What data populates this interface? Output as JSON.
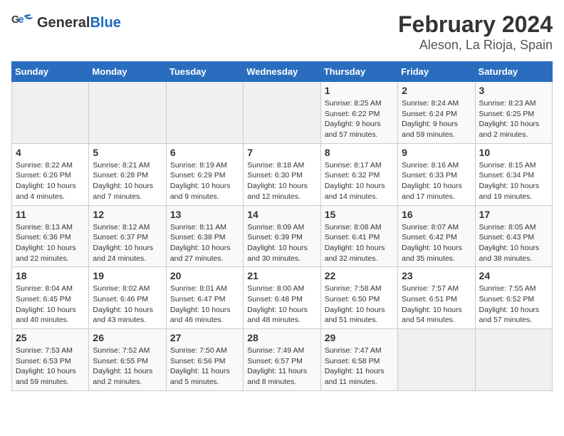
{
  "logo": {
    "text_general": "General",
    "text_blue": "Blue"
  },
  "title": "February 2024",
  "subtitle": "Aleson, La Rioja, Spain",
  "headers": [
    "Sunday",
    "Monday",
    "Tuesday",
    "Wednesday",
    "Thursday",
    "Friday",
    "Saturday"
  ],
  "weeks": [
    [
      {
        "day": "",
        "info": ""
      },
      {
        "day": "",
        "info": ""
      },
      {
        "day": "",
        "info": ""
      },
      {
        "day": "",
        "info": ""
      },
      {
        "day": "1",
        "info": "Sunrise: 8:25 AM\nSunset: 6:22 PM\nDaylight: 9 hours\nand 57 minutes."
      },
      {
        "day": "2",
        "info": "Sunrise: 8:24 AM\nSunset: 6:24 PM\nDaylight: 9 hours\nand 59 minutes."
      },
      {
        "day": "3",
        "info": "Sunrise: 8:23 AM\nSunset: 6:25 PM\nDaylight: 10 hours\nand 2 minutes."
      }
    ],
    [
      {
        "day": "4",
        "info": "Sunrise: 8:22 AM\nSunset: 6:26 PM\nDaylight: 10 hours\nand 4 minutes."
      },
      {
        "day": "5",
        "info": "Sunrise: 8:21 AM\nSunset: 6:28 PM\nDaylight: 10 hours\nand 7 minutes."
      },
      {
        "day": "6",
        "info": "Sunrise: 8:19 AM\nSunset: 6:29 PM\nDaylight: 10 hours\nand 9 minutes."
      },
      {
        "day": "7",
        "info": "Sunrise: 8:18 AM\nSunset: 6:30 PM\nDaylight: 10 hours\nand 12 minutes."
      },
      {
        "day": "8",
        "info": "Sunrise: 8:17 AM\nSunset: 6:32 PM\nDaylight: 10 hours\nand 14 minutes."
      },
      {
        "day": "9",
        "info": "Sunrise: 8:16 AM\nSunset: 6:33 PM\nDaylight: 10 hours\nand 17 minutes."
      },
      {
        "day": "10",
        "info": "Sunrise: 8:15 AM\nSunset: 6:34 PM\nDaylight: 10 hours\nand 19 minutes."
      }
    ],
    [
      {
        "day": "11",
        "info": "Sunrise: 8:13 AM\nSunset: 6:36 PM\nDaylight: 10 hours\nand 22 minutes."
      },
      {
        "day": "12",
        "info": "Sunrise: 8:12 AM\nSunset: 6:37 PM\nDaylight: 10 hours\nand 24 minutes."
      },
      {
        "day": "13",
        "info": "Sunrise: 8:11 AM\nSunset: 6:38 PM\nDaylight: 10 hours\nand 27 minutes."
      },
      {
        "day": "14",
        "info": "Sunrise: 8:09 AM\nSunset: 6:39 PM\nDaylight: 10 hours\nand 30 minutes."
      },
      {
        "day": "15",
        "info": "Sunrise: 8:08 AM\nSunset: 6:41 PM\nDaylight: 10 hours\nand 32 minutes."
      },
      {
        "day": "16",
        "info": "Sunrise: 8:07 AM\nSunset: 6:42 PM\nDaylight: 10 hours\nand 35 minutes."
      },
      {
        "day": "17",
        "info": "Sunrise: 8:05 AM\nSunset: 6:43 PM\nDaylight: 10 hours\nand 38 minutes."
      }
    ],
    [
      {
        "day": "18",
        "info": "Sunrise: 8:04 AM\nSunset: 6:45 PM\nDaylight: 10 hours\nand 40 minutes."
      },
      {
        "day": "19",
        "info": "Sunrise: 8:02 AM\nSunset: 6:46 PM\nDaylight: 10 hours\nand 43 minutes."
      },
      {
        "day": "20",
        "info": "Sunrise: 8:01 AM\nSunset: 6:47 PM\nDaylight: 10 hours\nand 46 minutes."
      },
      {
        "day": "21",
        "info": "Sunrise: 8:00 AM\nSunset: 6:48 PM\nDaylight: 10 hours\nand 48 minutes."
      },
      {
        "day": "22",
        "info": "Sunrise: 7:58 AM\nSunset: 6:50 PM\nDaylight: 10 hours\nand 51 minutes."
      },
      {
        "day": "23",
        "info": "Sunrise: 7:57 AM\nSunset: 6:51 PM\nDaylight: 10 hours\nand 54 minutes."
      },
      {
        "day": "24",
        "info": "Sunrise: 7:55 AM\nSunset: 6:52 PM\nDaylight: 10 hours\nand 57 minutes."
      }
    ],
    [
      {
        "day": "25",
        "info": "Sunrise: 7:53 AM\nSunset: 6:53 PM\nDaylight: 10 hours\nand 59 minutes."
      },
      {
        "day": "26",
        "info": "Sunrise: 7:52 AM\nSunset: 6:55 PM\nDaylight: 11 hours\nand 2 minutes."
      },
      {
        "day": "27",
        "info": "Sunrise: 7:50 AM\nSunset: 6:56 PM\nDaylight: 11 hours\nand 5 minutes."
      },
      {
        "day": "28",
        "info": "Sunrise: 7:49 AM\nSunset: 6:57 PM\nDaylight: 11 hours\nand 8 minutes."
      },
      {
        "day": "29",
        "info": "Sunrise: 7:47 AM\nSunset: 6:58 PM\nDaylight: 11 hours\nand 11 minutes."
      },
      {
        "day": "",
        "info": ""
      },
      {
        "day": "",
        "info": ""
      }
    ]
  ]
}
